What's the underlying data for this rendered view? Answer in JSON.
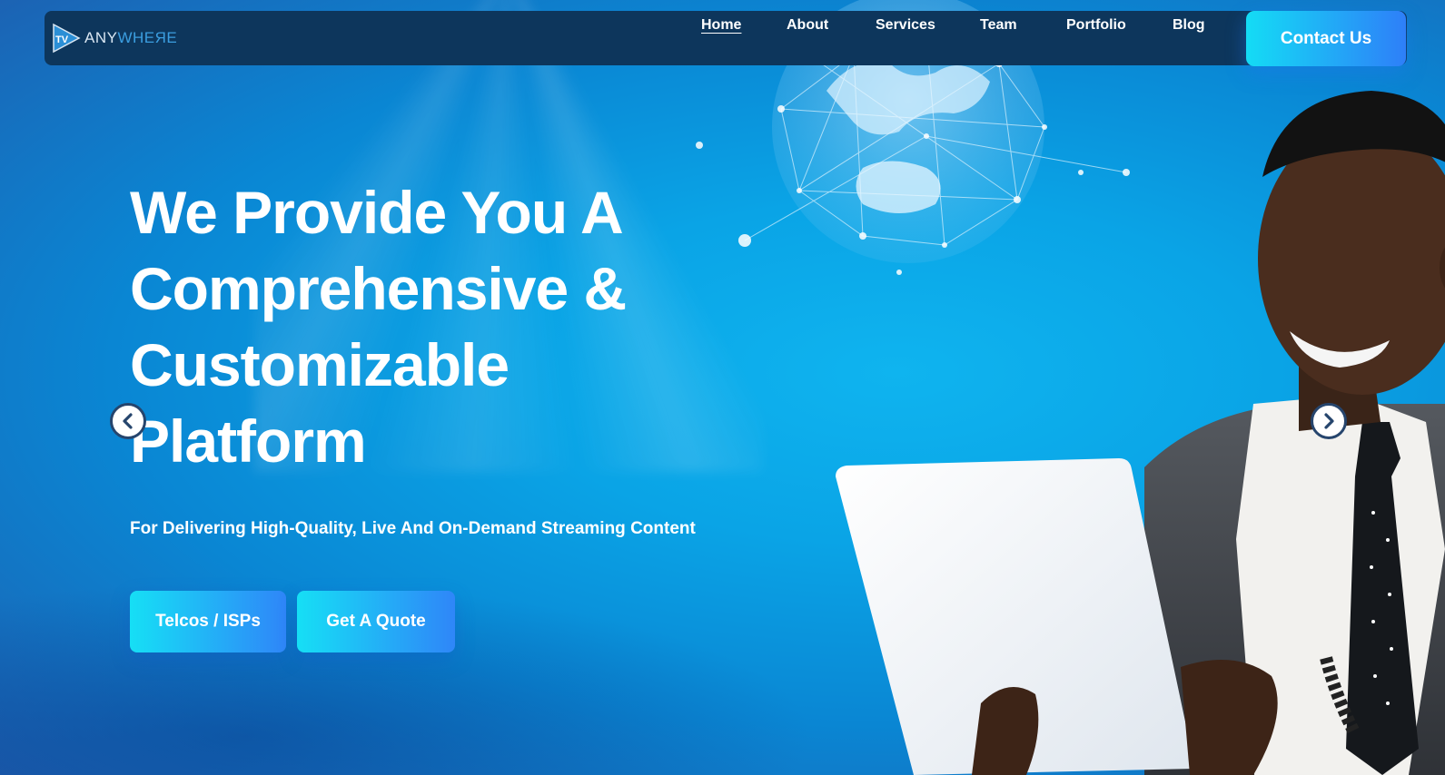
{
  "brand": {
    "logo_mark": "TV",
    "logo_word_a": "ANY",
    "logo_word_b": "WHEЯE"
  },
  "nav": {
    "items": [
      {
        "label": "Home",
        "active": true
      },
      {
        "label": "About",
        "active": false
      },
      {
        "label": "Services",
        "active": false
      },
      {
        "label": "Team",
        "active": false
      },
      {
        "label": "Portfolio",
        "active": false
      },
      {
        "label": "Blog",
        "active": false
      }
    ],
    "contact_label": "Contact Us"
  },
  "hero": {
    "headline_lines": [
      "We Provide You A",
      "Comprehensive &",
      "Customizable",
      "Platform"
    ],
    "subtitle": "For Delivering High-Quality, Live And On-Demand Streaming Content",
    "cta_primary": "Telcos / ISPs",
    "cta_secondary": "Get A Quote"
  },
  "slider": {
    "prev_icon": "chevron-left-icon",
    "next_icon": "chevron-right-icon"
  },
  "colors": {
    "nav_bg": "#0d365c",
    "button_gradient_start": "#14dcf5",
    "button_gradient_end": "#2e7ff8",
    "hero_bg": "#0aa4e6"
  }
}
